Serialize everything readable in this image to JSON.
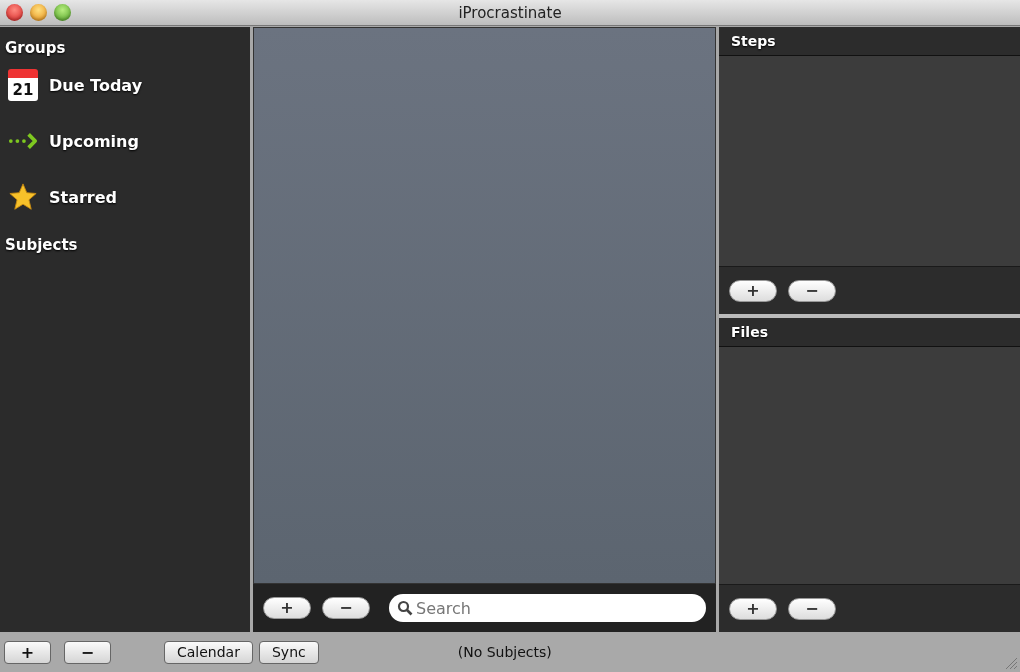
{
  "window": {
    "title": "iProcrastinate"
  },
  "sidebar": {
    "groups_heading": "Groups",
    "groups": [
      {
        "kind": "calendar",
        "label": "Due Today",
        "icon_text": "21"
      },
      {
        "kind": "arrow",
        "label": "Upcoming"
      },
      {
        "kind": "star",
        "label": "Starred"
      }
    ],
    "subjects_heading": "Subjects"
  },
  "task_list": {
    "add": "+",
    "remove": "−",
    "search": {
      "placeholder": "Search"
    }
  },
  "steps": {
    "title": "Steps",
    "add": "+",
    "remove": "−"
  },
  "files": {
    "title": "Files",
    "add": "+",
    "remove": "−"
  },
  "bottom_bar": {
    "add": "+",
    "remove": "−",
    "buttons": [
      "Calendar",
      "Sync"
    ],
    "status": "(No Subjects)"
  }
}
